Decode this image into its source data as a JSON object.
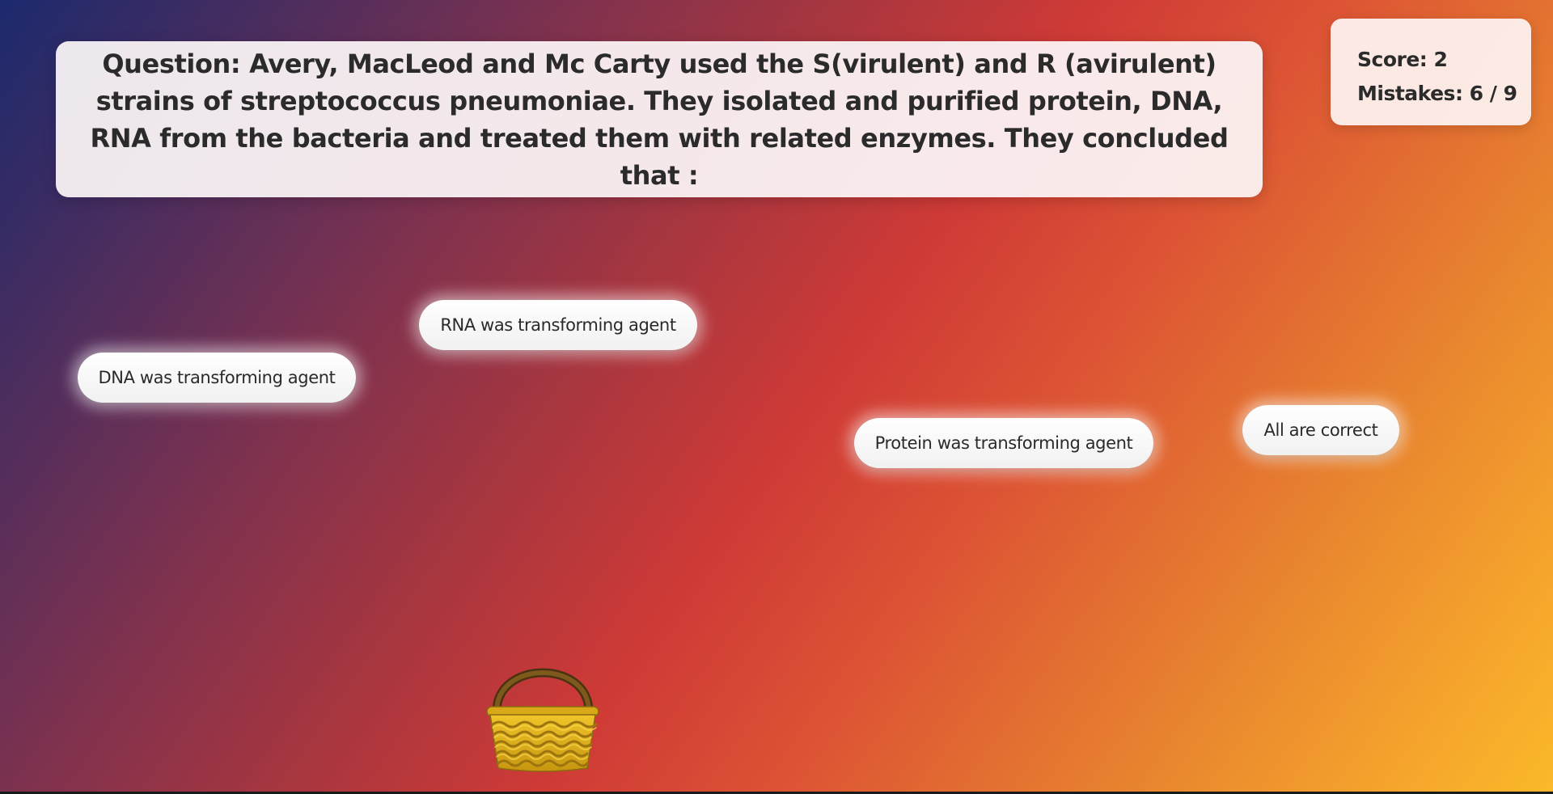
{
  "question": {
    "text": "Question: Avery, MacLeod and Mc Carty used the S(virulent) and R (avirulent) strains of streptococcus pneumoniae. They isolated and purified protein, DNA, RNA from the bacteria and treated them with related enzymes. They concluded that :"
  },
  "stats": {
    "score": "Score: 2",
    "mistakes": "Mistakes: 6 / 9"
  },
  "answers": [
    {
      "label": "RNA was transforming agent"
    },
    {
      "label": "DNA was transforming agent"
    },
    {
      "label": "Protein was transforming agent"
    },
    {
      "label": "All are correct"
    }
  ],
  "basket": {
    "icon": "basket-icon",
    "colors": {
      "weave": "#e0b21a",
      "handle": "#6b4a16"
    }
  },
  "colors": {
    "panel_bg": "#fcf6f7",
    "text": "#2b2b2b",
    "gradient_start": "#1c2a6e",
    "gradient_mid": "#cf3a36",
    "gradient_end": "#fbb92a"
  }
}
